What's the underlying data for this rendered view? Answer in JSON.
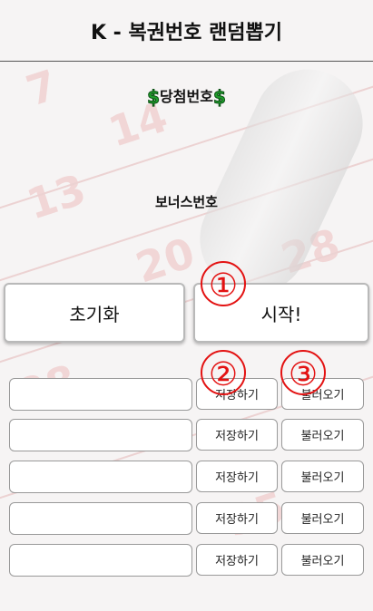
{
  "header": {
    "title": "K - 복권번호 랜덤뽑기"
  },
  "winning": {
    "label": "당첨번호",
    "symbol": "$"
  },
  "bonus": {
    "label": "보너스번호"
  },
  "actions": {
    "reset_label": "초기화",
    "start_label": "시작!"
  },
  "saved_rows": [
    {
      "value": "",
      "save_label": "저장하기",
      "load_label": "불러오기"
    },
    {
      "value": "",
      "save_label": "저장하기",
      "load_label": "불러오기"
    },
    {
      "value": "",
      "save_label": "저장하기",
      "load_label": "불러오기"
    },
    {
      "value": "",
      "save_label": "저장하기",
      "load_label": "불러오기"
    },
    {
      "value": "",
      "save_label": "저장하기",
      "load_label": "불러오기"
    }
  ],
  "annotations": [
    "①",
    "②",
    "③"
  ],
  "colors": {
    "accent_red": "#e31212",
    "dollar_green": "#1f9d2b"
  }
}
